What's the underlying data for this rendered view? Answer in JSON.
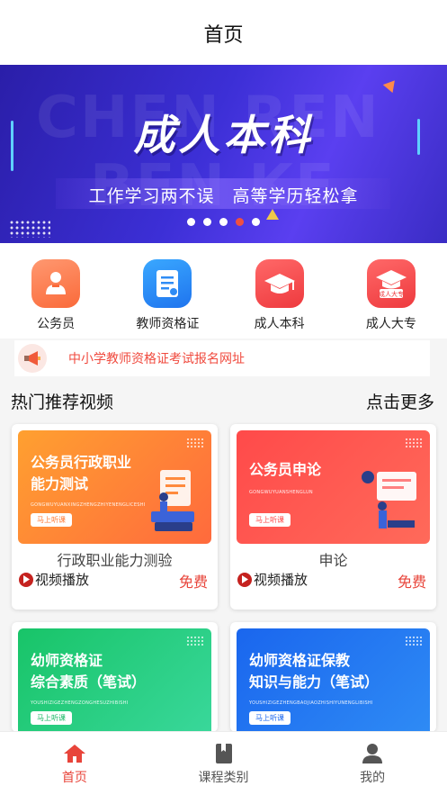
{
  "header": {
    "title": "首页"
  },
  "banner": {
    "bg_text_line1": "CHEN REN",
    "bg_text_line2": "BEN KE",
    "headline": "成人本科",
    "subline": "工作学习两不误　高等学历轻松拿",
    "page_count": 5,
    "active_index": 3
  },
  "categories": [
    {
      "label": "公务员",
      "icon": "civil-servant-icon",
      "color": "#fb7b4f"
    },
    {
      "label": "教师资格证",
      "icon": "teacher-cert-icon",
      "color": "#2f8cf5"
    },
    {
      "label": "成人本科",
      "icon": "grad-cap-icon",
      "color": "#f2474b"
    },
    {
      "label": "成人大专",
      "icon": "grad-cap-badge-icon",
      "color": "#f2474b"
    }
  ],
  "notice": {
    "text": "中小学教师资格证考试报名网址",
    "icon": "megaphone-icon"
  },
  "section": {
    "title": "热门推荐视频",
    "more": "点击更多"
  },
  "videos": [
    {
      "thumb_line1": "公务员行政职业",
      "thumb_line2": "能力测试",
      "thumb_pinyin": "GONGWUYUANXINGZHENGZHIYENENGLICESHI",
      "thumb_button": "马上听课",
      "title": "行政职业能力测验",
      "play_label": "视频播放",
      "price": "免费",
      "gradient": [
        "#ff9a2e",
        "#ff6a3d"
      ]
    },
    {
      "thumb_line1": "公务员申论",
      "thumb_line2": "",
      "thumb_pinyin": "GONGWUYUANSHENGLUN",
      "thumb_button": "马上听课",
      "title": "申论",
      "play_label": "视频播放",
      "price": "免费",
      "gradient": [
        "#ff4a4a",
        "#ff6a5a"
      ]
    },
    {
      "thumb_line1": "幼师资格证",
      "thumb_line2": "综合素质（笔试）",
      "thumb_pinyin": "YOUSHIZIGEZHENGZONGHESUZHIBISHI",
      "thumb_button": "马上听课",
      "title": "",
      "play_label": "",
      "price": "",
      "gradient": [
        "#1fc96b",
        "#34d89a"
      ]
    },
    {
      "thumb_line1": "幼师资格证保教",
      "thumb_line2": "知识与能力（笔试）",
      "thumb_pinyin": "YOUSHIZIGEZHENGBAOJIAOZHISHIYUNENGLIBISHI",
      "thumb_button": "马上听课",
      "title": "",
      "play_label": "",
      "price": "",
      "gradient": [
        "#1f6ef0",
        "#2f8cf5"
      ]
    }
  ],
  "tabbar": [
    {
      "label": "首页",
      "icon": "home-icon",
      "active": true
    },
    {
      "label": "课程类别",
      "icon": "book-icon",
      "active": false
    },
    {
      "label": "我的",
      "icon": "person-icon",
      "active": false
    }
  ],
  "colors": {
    "accent": "#e8443a",
    "banner": "#3c2fd6"
  }
}
